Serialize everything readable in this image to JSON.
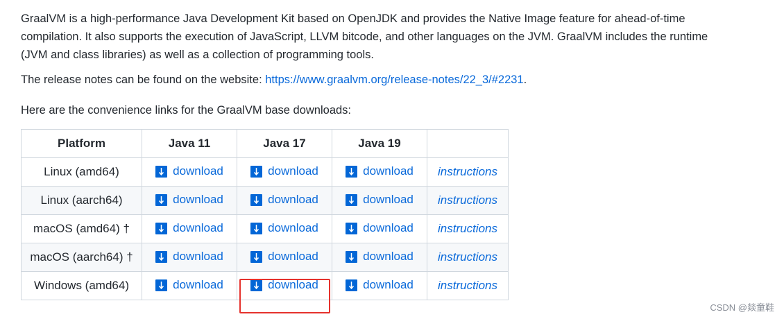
{
  "paragraphs": {
    "intro": "GraalVM is a high-performance Java Development Kit based on OpenJDK and provides the Native Image feature for ahead-of-time compilation. It also supports the execution of JavaScript, LLVM bitcode, and other languages on the JVM. GraalVM includes the runtime (JVM and class libraries) as well as a collection of programming tools.",
    "notes_prefix": "The release notes can be found on the website: ",
    "notes_link": "https://www.graalvm.org/release-notes/22_3/#2231",
    "notes_suffix": ".",
    "lead": "Here are the convenience links for the GraalVM base downloads:"
  },
  "table": {
    "headers": [
      "Platform",
      "Java 11",
      "Java 17",
      "Java 19",
      ""
    ],
    "download_label": "download",
    "instructions_label": "instructions",
    "rows": [
      {
        "platform": "Linux (amd64)"
      },
      {
        "platform": "Linux (aarch64)"
      },
      {
        "platform": "macOS (amd64) †"
      },
      {
        "platform": "macOS (aarch64) †"
      },
      {
        "platform": "Windows (amd64)"
      }
    ]
  },
  "highlight": {
    "row": 4,
    "column": "Java 17",
    "color": "#e5322d"
  },
  "colors": {
    "link": "#0969da",
    "icon": "#0366d6",
    "border": "#d0d7de",
    "stripe": "#f6f8fa"
  },
  "watermark": "CSDN @燚童鞋"
}
